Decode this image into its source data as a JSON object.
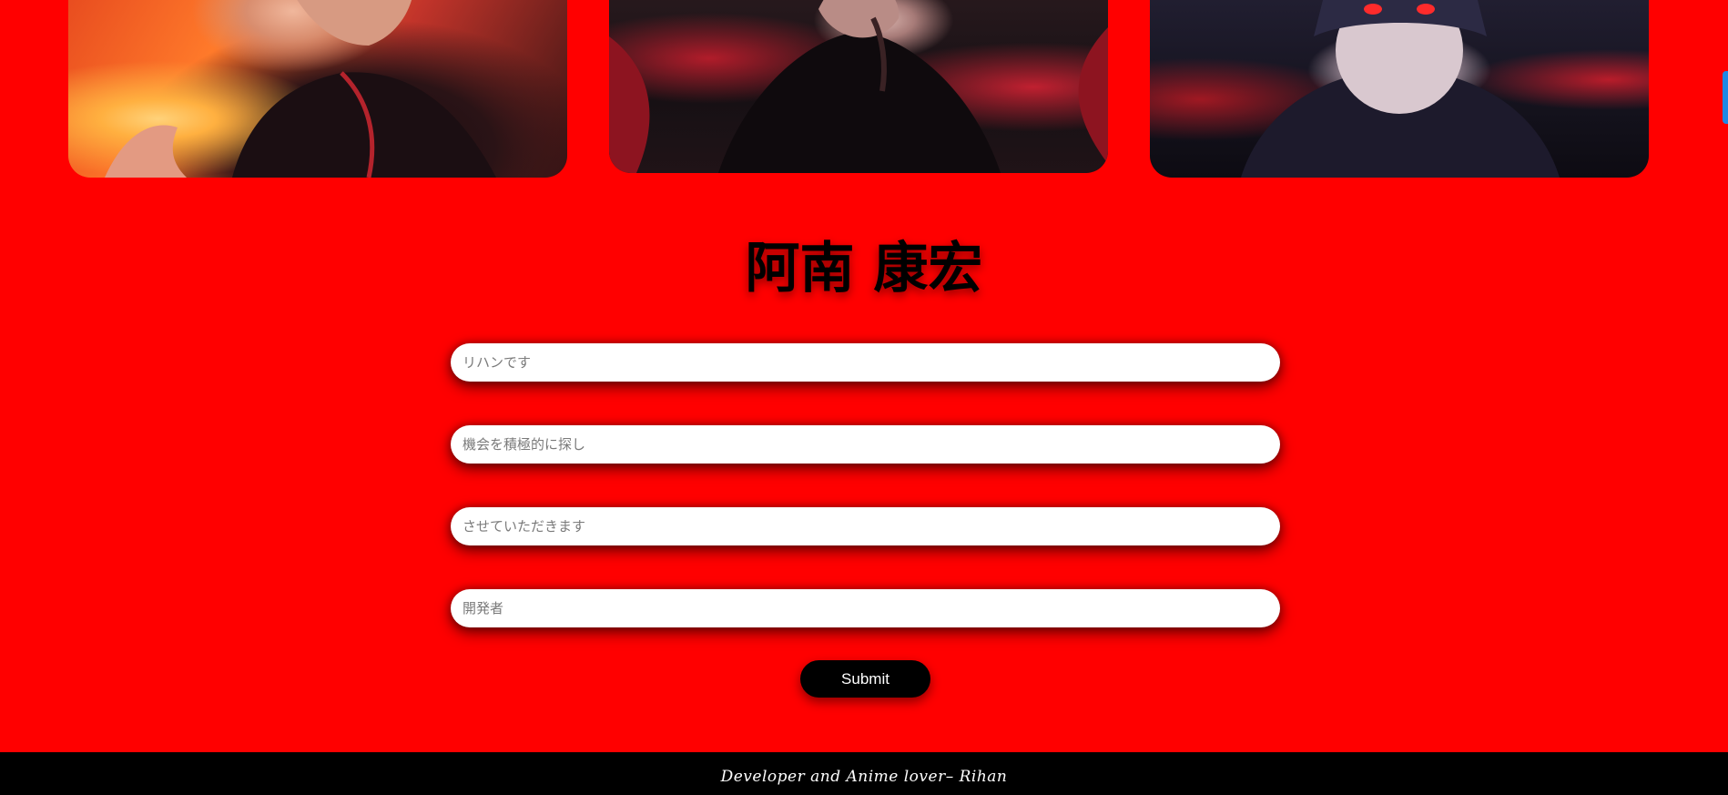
{
  "gallery": {
    "images": [
      {
        "alt": "anime character with fire"
      },
      {
        "alt": "anime character in red flames"
      },
      {
        "alt": "anime character with glowing red eyes"
      }
    ]
  },
  "title": "阿南 康宏",
  "form": {
    "fields": [
      {
        "placeholder": "リハンです"
      },
      {
        "placeholder": "機会を積極的に探し"
      },
      {
        "placeholder": "させていただきます"
      },
      {
        "placeholder": "開発者"
      }
    ],
    "submit_label": "Submit"
  },
  "footer": {
    "text": "Developer and Anime lover– Rihan"
  },
  "colors": {
    "background": "#ff0000",
    "footer": "#000000",
    "button": "#000000",
    "side_tab": "#1e88e5"
  }
}
